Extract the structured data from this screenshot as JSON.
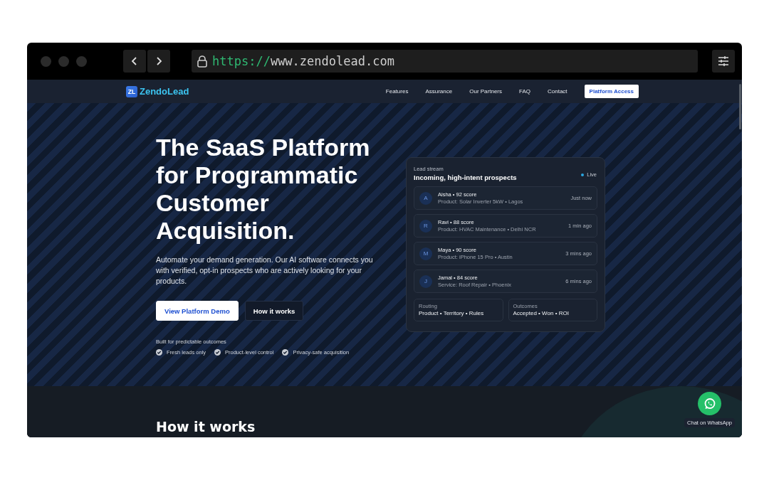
{
  "browser": {
    "url_scheme": "https://",
    "url_host": "www.zendolead.com"
  },
  "nav": {
    "logo_mark": "ZL",
    "logo_text": "ZendoLead",
    "links": [
      {
        "label": "Features",
        "kind": "link"
      },
      {
        "label": "Assurance",
        "kind": "link"
      },
      {
        "label": "Our Partners",
        "kind": "link"
      },
      {
        "label": "FAQ",
        "kind": "link"
      },
      {
        "label": "Contact",
        "kind": "link"
      },
      {
        "label": "Platform Access",
        "kind": "button"
      }
    ]
  },
  "hero": {
    "heading_lines": [
      "The SaaS Platform",
      "for Programmatic",
      "Customer",
      "Acquisition."
    ],
    "text": "Automate your demand generation. Our AI software connects you with verified, opt-in prospects who are actively looking for your products.",
    "buttons": [
      {
        "label": "View Platform Demo",
        "kind": "primary"
      },
      {
        "label": "How it works",
        "kind": "secondary"
      }
    ],
    "trust_title": "Built for predictable outcomes",
    "trust_items": [
      "Fresh leads only",
      "Product-level control",
      "Privacy-safe acquisition"
    ]
  },
  "lead_stream": {
    "eyebrow": "Lead stream",
    "title": "Incoming, high-intent prospects",
    "status": "Live",
    "leads": [
      {
        "initial": "A",
        "name": "Aisha • 92 score",
        "detail": "Product: Solar Inverter 5kW • Lagos",
        "time": "Just now"
      },
      {
        "initial": "R",
        "name": "Ravi • 88 score",
        "detail": "Product: HVAC Maintenance • Delhi NCR",
        "time": "1 min ago"
      },
      {
        "initial": "M",
        "name": "Maya • 90 score",
        "detail": "Product: iPhone 15 Pro • Austin",
        "time": "3 mins ago"
      },
      {
        "initial": "J",
        "name": "Jamal • 84 score",
        "detail": "Service: Roof Repair • Phoenix",
        "time": "6 mins ago"
      }
    ],
    "summaries": [
      {
        "label": "Routing",
        "value": "Product • Territory • Rules"
      },
      {
        "label": "Outcomes",
        "value": "Accepted • Won • ROI"
      }
    ]
  },
  "section": {
    "title": "How it works"
  },
  "chat": {
    "label": "Chat on WhatsApp"
  }
}
